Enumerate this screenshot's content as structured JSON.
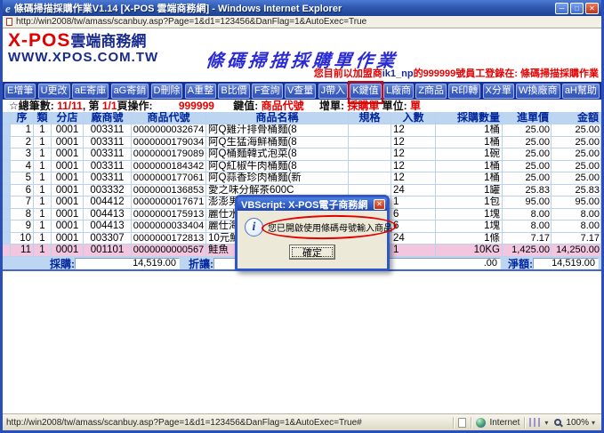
{
  "window": {
    "title": "條碼掃描採購作業V1.14 [X-POS 雲端商務網] - Windows Internet Explorer",
    "address_url": "http://win2008/tw/amass/scanbuy.asp?Page=1&d1=123456&DanFlag=1&AutoExec=True",
    "controls": {
      "minimize": "─",
      "maximize": "□",
      "close": "✕"
    }
  },
  "header": {
    "logo_main": "X-POS",
    "logo_suffix": "雲端商務網",
    "logo_site": "WWW.XPOS.COM.TW",
    "page_title": "條碼掃描採購單作業",
    "login": {
      "prefix": "您目前以加盟商",
      "member": "ik1_np",
      "mid": "的",
      "employee": "999999",
      "suffix": "號員工登錄在: 條碼掃描採購作業"
    }
  },
  "toolbar": {
    "buttons": [
      "E增筆",
      "U更改",
      "aE寄庫",
      "aG寄銷",
      "D刪除",
      "A重整",
      "B比價",
      "F查詢",
      "V查量",
      "J帶入",
      "K鍵值",
      "L廠商",
      "Z商品",
      "R印轉",
      "X分單",
      "W換廠商",
      "aH幫助"
    ],
    "highlighted_button": "K鍵值"
  },
  "status_line": {
    "total_label": "☆總筆數:",
    "total_value": "11/11",
    "page_label": ", 第",
    "page_value": "1/1",
    "op_label": "頁操作:",
    "operator": "999999",
    "key_label": "鍵值:",
    "key_value": "商品代號",
    "add_label": "增單:",
    "add_value": "採購單",
    "unit_label": "單位:",
    "unit_value": "單"
  },
  "table": {
    "columns": [
      "序",
      "類",
      "分店",
      "廠商號",
      "商品代號",
      "商品名稱",
      "規格",
      "入數",
      "採購數量",
      "進單價",
      "金額"
    ],
    "rows": [
      [
        "1",
        "1",
        "0001",
        "003311",
        "0000000032674",
        "阿Q雞汁排骨桶麵(8",
        "",
        "12",
        "1桶",
        "25.00",
        "25.00"
      ],
      [
        "2",
        "1",
        "0001",
        "003311",
        "0000000179034",
        "阿Q生猛海鮮桶麵(8",
        "",
        "12",
        "1桶",
        "25.00",
        "25.00"
      ],
      [
        "3",
        "1",
        "0001",
        "003311",
        "0000000179089",
        "阿Q桶麵韓式泡菜(8",
        "",
        "12",
        "1碗",
        "25.00",
        "25.00"
      ],
      [
        "4",
        "1",
        "0001",
        "003311",
        "0000000184342",
        "阿Q紅椒牛肉桶麵(8",
        "",
        "12",
        "1桶",
        "25.00",
        "25.00"
      ],
      [
        "5",
        "1",
        "0001",
        "003311",
        "0000000177061",
        "阿Q蒜香珍肉桶麵(新",
        "",
        "12",
        "1桶",
        "25.00",
        "25.00"
      ],
      [
        "6",
        "1",
        "0001",
        "003332",
        "0000000136853",
        "愛之味分解茶600C",
        "",
        "24",
        "1罐",
        "25.83",
        "25.83"
      ],
      [
        "7",
        "1",
        "0001",
        "004412",
        "0000000017671",
        "澎澎男性",
        "",
        "1",
        "1包",
        "95.00",
        "95.00"
      ],
      [
        "8",
        "1",
        "0001",
        "004413",
        "0000000175913",
        "麗仕水",
        "",
        "6",
        "1塊",
        "8.00",
        "8.00"
      ],
      [
        "9",
        "1",
        "0001",
        "004413",
        "0000000033404",
        "麗仕海",
        "",
        "6",
        "1塊",
        "8.00",
        "8.00"
      ],
      [
        "10",
        "1",
        "0001",
        "003307",
        "0000000172813",
        "10元鮮",
        "",
        "24",
        "1條",
        "7.17",
        "7.17"
      ],
      [
        "11",
        "1",
        "0001",
        "001101",
        "0000000000567",
        "鮭魚",
        "",
        "1",
        "10KG",
        "1,425.00",
        "14,250.00"
      ]
    ],
    "selected_row": 11
  },
  "summary": {
    "purchase_label": "採購:",
    "purchase_value": "14,519.00",
    "discount_label": "折讓:",
    "discount_value": ".00",
    "net_label": "淨額:",
    "net_value": "14,519.00"
  },
  "dialog": {
    "title": "VBScript: X-POS電子商務網",
    "message": "您已開啟使用條碼母號輸入商品",
    "ok_label": "確定"
  },
  "statusbar": {
    "url": "http://win2008/tw/amass/scanbuy.asp?Page=1&d1=123456&DanFlag=1&AutoExec=True#",
    "zone_label": "Internet",
    "zoom_level": "100%"
  }
}
